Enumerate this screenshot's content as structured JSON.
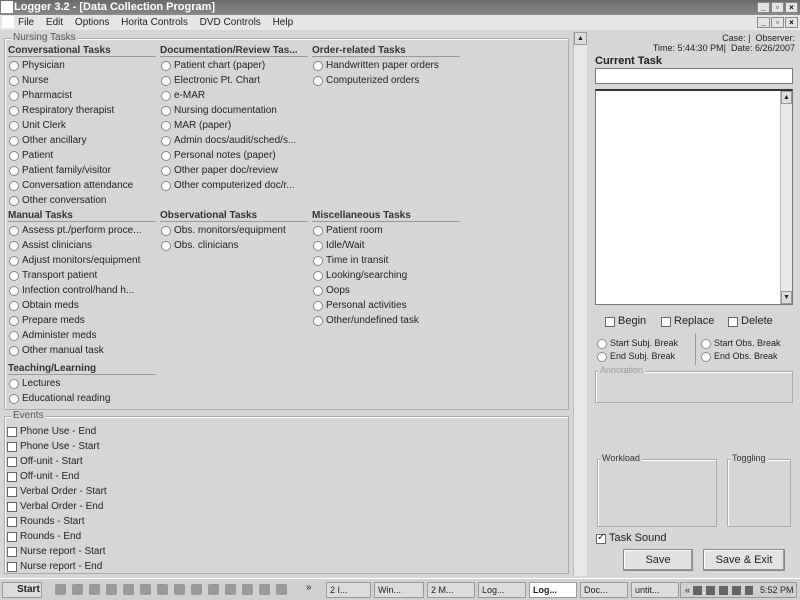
{
  "window": {
    "title": "Logger 3.2 - [Data Collection Program]",
    "min": "_",
    "max": "▫",
    "close": "×"
  },
  "menu": [
    "File",
    "Edit",
    "Options",
    "Horita Controls",
    "DVD Controls",
    "Help"
  ],
  "nursing": {
    "label": "Nursing Tasks",
    "sections": [
      {
        "title": "Conversational Tasks",
        "items": [
          "Physician",
          "Nurse",
          "Pharmacist",
          "Respiratory therapist",
          "Unit Clerk",
          "Other ancillary",
          "Patient",
          "Patient family/visitor",
          "Conversation attendance",
          "Other conversation"
        ]
      },
      {
        "title": "Documentation/Review Tas...",
        "items": [
          "Patient chart (paper)",
          "Electronic Pt. Chart",
          "e-MAR",
          "Nursing documentation",
          "MAR (paper)",
          "Admin docs/audit/sched/s...",
          "Personal notes (paper)",
          "Other paper doc/review",
          "Other computerized doc/r..."
        ]
      },
      {
        "title": "Order-related Tasks",
        "items": [
          "Handwritten paper orders",
          "Computerized orders"
        ]
      },
      {
        "title": "Manual Tasks",
        "items": [
          "Assess pt./perform proce...",
          "Assist clinicians",
          "Adjust monitors/equipment",
          "Transport patient",
          "Infection control/hand h...",
          "Obtain meds",
          "Prepare meds",
          "Administer meds",
          "Other manual task"
        ]
      },
      {
        "title": "Observational Tasks",
        "items": [
          "Obs. monitors/equipment",
          "Obs. clinicians"
        ]
      },
      {
        "title": "Miscellaneous Tasks",
        "items": [
          "Patient room",
          "Idle/Wait",
          "Time in transit",
          "Looking/searching",
          "Oops",
          "Personal activities",
          "Other/undefined task"
        ]
      },
      {
        "title": "Teaching/Learning",
        "items": [
          "Lectures",
          "Educational reading"
        ]
      }
    ]
  },
  "events": {
    "label": "Events",
    "items": [
      "Phone Use - End",
      "Phone Use - Start",
      "Off-unit - Start",
      "Off-unit - End",
      "Verbal Order - Start",
      "Verbal Order - End",
      "Rounds - Start",
      "Rounds - End",
      "Nurse report - Start",
      "Nurse report - End"
    ]
  },
  "right": {
    "case": "Case: |",
    "observer": "Observer:",
    "time": "Time: 5:44:30 PM|",
    "date": "Date: 6/26/2007",
    "current_task_label": "Current Task",
    "current_task_value": "",
    "begin": "Begin",
    "replace": "Replace",
    "delete": "Delete",
    "start_subj": "Start Subj. Break",
    "end_subj": "End Subj. Break",
    "start_obs": "Start Obs. Break",
    "end_obs": "End Obs. Break",
    "annotation": "Annotation",
    "workload": "Workload",
    "toggling": "Toggling",
    "task_sound": "Task Sound",
    "task_sound_checked": true,
    "save": "Save",
    "save_exit": "Save & Exit"
  },
  "taskbar": {
    "start": "Start",
    "more": "»",
    "buttons": [
      "2 I...",
      "Win...",
      "2 M...",
      "Log...",
      "Log...",
      "Doc...",
      "untit..."
    ],
    "tray_more": "«",
    "clock": "5:52 PM"
  }
}
